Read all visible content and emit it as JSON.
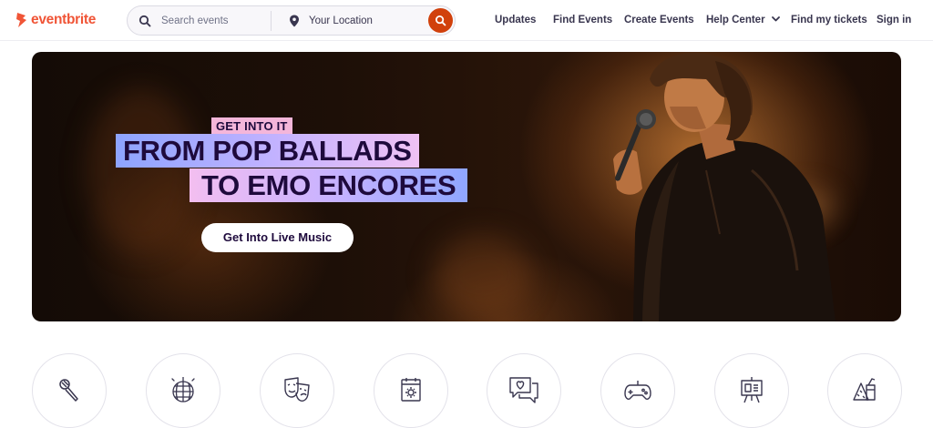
{
  "brand": {
    "name": "eventbrite",
    "color": "#f05537"
  },
  "search": {
    "placeholder": "Search events",
    "location_placeholder": "Your Location",
    "button_color": "#d1410c"
  },
  "nav": {
    "items": [
      "Updates",
      "Find Events",
      "Create Events",
      "Help Center",
      "Find my tickets",
      "Sign in"
    ]
  },
  "hero": {
    "kicker": "GET INTO IT",
    "headline_line1": "FROM POP BALLADS",
    "headline_line2": "TO EMO ENCORES",
    "cta_label": "Get Into Live Music"
  },
  "categories": [
    {
      "icon": "microphone-icon"
    },
    {
      "icon": "disco-ball-icon"
    },
    {
      "icon": "theater-masks-icon"
    },
    {
      "icon": "calendar-icon"
    },
    {
      "icon": "chat-heart-icon"
    },
    {
      "icon": "game-controller-icon"
    },
    {
      "icon": "easel-icon"
    },
    {
      "icon": "party-drinks-icon"
    }
  ]
}
